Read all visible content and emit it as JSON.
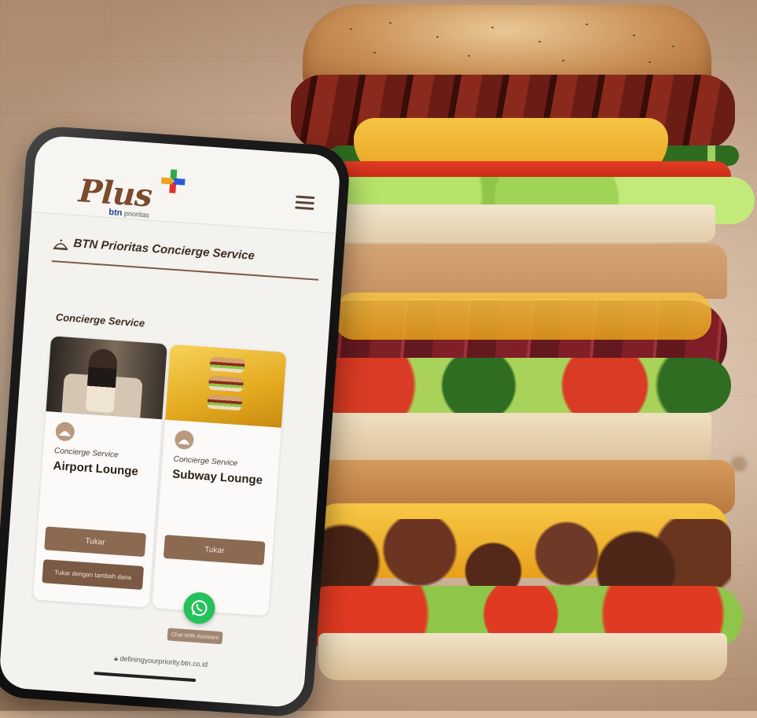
{
  "app": {
    "logo_text": "Plus",
    "logo_sub_brand": "btn",
    "logo_sub_suffix": "prioritas",
    "page_title": "BTN Prioritas Concierge Service",
    "section_label": "Concierge Service"
  },
  "cards": [
    {
      "kicker": "Concierge Service",
      "title": "Airport Lounge",
      "primary_label": "Tukar",
      "secondary_label": "Tukar dengan tambah dana"
    },
    {
      "kicker": "Concierge Service",
      "title": "Subway Lounge",
      "primary_label": "Tukar"
    }
  ],
  "whatsapp": {
    "label": "Chat With Assistant"
  },
  "url": "definingyourpriority.btn.co.id",
  "colors": {
    "brand_brown": "#7a4b2c",
    "button_brown": "#8c6a52",
    "whatsapp_green": "#25c15b"
  }
}
